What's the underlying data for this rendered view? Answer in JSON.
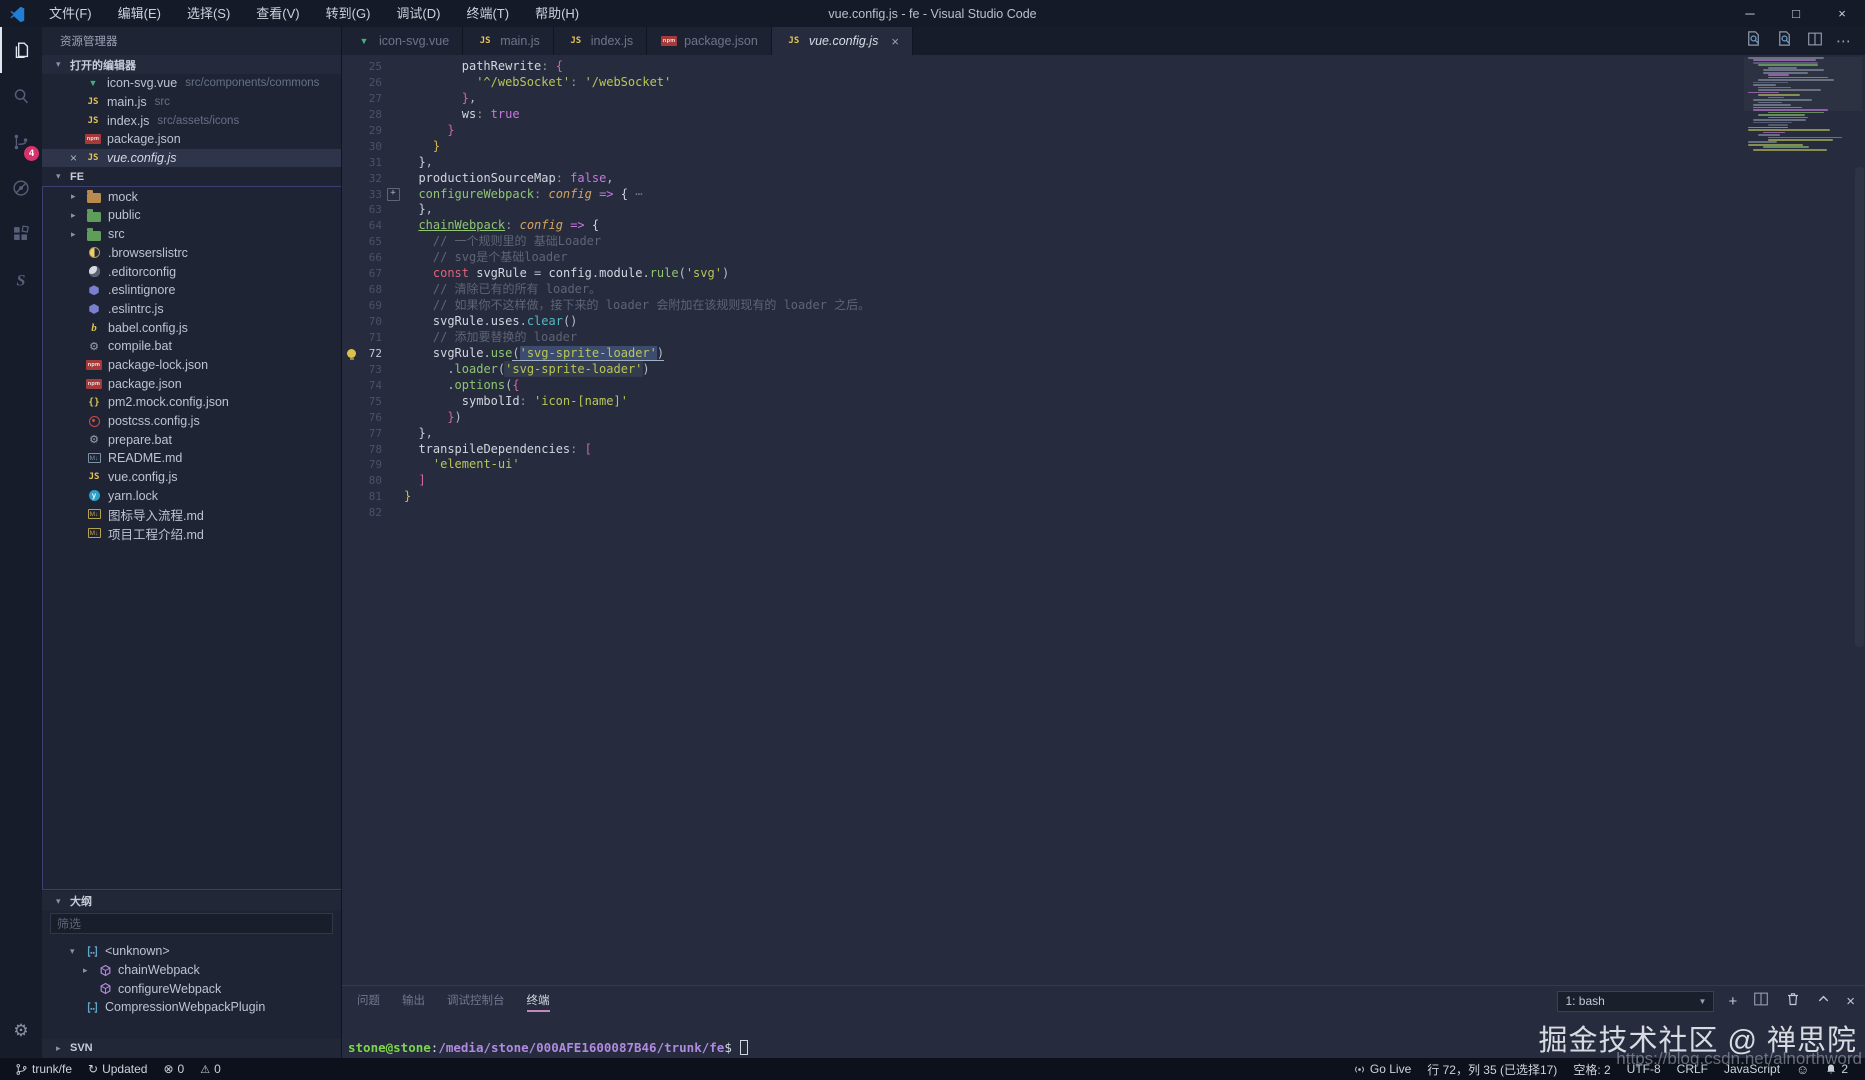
{
  "window": {
    "title": "vue.config.js - fe - Visual Studio Code",
    "menus": [
      "文件(F)",
      "编辑(E)",
      "选择(S)",
      "查看(V)",
      "转到(G)",
      "调试(D)",
      "终端(T)",
      "帮助(H)"
    ],
    "controls": [
      {
        "name": "minimize",
        "glyph": "─"
      },
      {
        "name": "maximize",
        "glyph": "□"
      },
      {
        "name": "close",
        "glyph": "×"
      }
    ]
  },
  "activity_bar": {
    "items": [
      {
        "name": "explorer",
        "active": true
      },
      {
        "name": "search"
      },
      {
        "name": "source-control",
        "badge": "4"
      },
      {
        "name": "debug"
      },
      {
        "name": "extensions"
      },
      {
        "name": "svn"
      }
    ],
    "bottom": [
      {
        "name": "settings",
        "glyph": "⚙"
      }
    ]
  },
  "sidebar": {
    "title": "资源管理器",
    "open_editors": {
      "label": "打开的编辑器",
      "items": [
        {
          "icon": "vue",
          "label": "icon-svg.vue",
          "desc": "src/components/commons"
        },
        {
          "icon": "js",
          "label": "main.js",
          "desc": "src"
        },
        {
          "icon": "js",
          "label": "index.js",
          "desc": "src/assets/icons"
        },
        {
          "icon": "npm",
          "label": "package.json",
          "desc": ""
        },
        {
          "icon": "js",
          "label": "vue.config.js",
          "desc": "",
          "active": true
        }
      ]
    },
    "tree": {
      "root": "FE",
      "items": [
        {
          "icon": "folder",
          "color": "#b98a4e",
          "label": "mock",
          "twisty": true
        },
        {
          "icon": "folder",
          "color": "#5e9e5a",
          "label": "public",
          "twisty": true
        },
        {
          "icon": "folder",
          "color": "#5e9e5a",
          "label": "src",
          "twisty": true
        },
        {
          "icon": "browserslist",
          "label": ".browserslistrc"
        },
        {
          "icon": "editorconfig",
          "label": ".editorconfig"
        },
        {
          "icon": "eslint",
          "label": ".eslintignore"
        },
        {
          "icon": "eslint",
          "label": ".eslintrc.js"
        },
        {
          "icon": "babel",
          "label": "babel.config.js"
        },
        {
          "icon": "gear",
          "label": "compile.bat"
        },
        {
          "icon": "npm",
          "label": "package-lock.json"
        },
        {
          "icon": "npm",
          "label": "package.json"
        },
        {
          "icon": "braces",
          "label": "pm2.mock.config.json"
        },
        {
          "icon": "postcss",
          "label": "postcss.config.js"
        },
        {
          "icon": "gear",
          "label": "prepare.bat"
        },
        {
          "icon": "markdown",
          "color": "#7c93a6",
          "label": "README.md"
        },
        {
          "icon": "js",
          "label": "vue.config.js"
        },
        {
          "icon": "yarn",
          "label": "yarn.lock"
        },
        {
          "icon": "markdown",
          "color": "#b7a14f",
          "label": "图标导入流程.md"
        },
        {
          "icon": "markdown",
          "color": "#b7a14f",
          "label": "项目工程介绍.md"
        }
      ]
    },
    "outline": {
      "label": "大纲",
      "filter_placeholder": "筛选",
      "items": [
        {
          "icon": "module",
          "label": "<unknown>",
          "twisty": "open",
          "indent": 0
        },
        {
          "icon": "method",
          "label": "chainWebpack",
          "twisty": "closed",
          "indent": 1
        },
        {
          "icon": "method",
          "label": "configureWebpack",
          "indent": 1
        },
        {
          "icon": "module",
          "label": "CompressionWebpackPlugin",
          "indent": 0
        }
      ]
    },
    "svn_label": "SVN"
  },
  "editor": {
    "tabs": [
      {
        "icon": "vue",
        "label": "icon-svg.vue"
      },
      {
        "icon": "js",
        "label": "main.js"
      },
      {
        "icon": "js",
        "label": "index.js"
      },
      {
        "icon": "npm",
        "label": "package.json"
      },
      {
        "icon": "js",
        "label": "vue.config.js",
        "active": true,
        "close": "×"
      }
    ],
    "actions": [
      {
        "name": "search-editor",
        "icon": "search-doc"
      },
      {
        "name": "search-history",
        "icon": "search-doc"
      },
      {
        "name": "split-editor",
        "icon": "split"
      },
      {
        "name": "more-actions",
        "icon": "ellipsis",
        "glyph": "⋯"
      }
    ],
    "lines": [
      {
        "n": 25,
        "ind": 4,
        "tk": [
          [
            "pr",
            "pathRewrite"
          ],
          [
            "pn",
            ": "
          ],
          [
            "b3",
            "{"
          ]
        ]
      },
      {
        "n": 26,
        "ind": 5,
        "tk": [
          [
            "st",
            "'^/webSocket'"
          ],
          [
            "pn",
            ": "
          ],
          [
            "st",
            "'/webSocket'"
          ]
        ]
      },
      {
        "n": 27,
        "ind": 4,
        "tk": [
          [
            "b3",
            "}"
          ],
          [
            "pu",
            ","
          ]
        ]
      },
      {
        "n": 28,
        "ind": 4,
        "tk": [
          [
            "pr",
            "ws"
          ],
          [
            "pn",
            ": "
          ],
          [
            "bo",
            "true"
          ]
        ]
      },
      {
        "n": 29,
        "ind": 3,
        "tk": [
          [
            "b3",
            "}"
          ]
        ]
      },
      {
        "n": 30,
        "ind": 2,
        "tk": [
          [
            "b1",
            "}"
          ]
        ]
      },
      {
        "n": 31,
        "ind": 1,
        "tk": [
          [
            "b2",
            "}"
          ],
          [
            "pu",
            ","
          ]
        ]
      },
      {
        "n": 32,
        "ind": 1,
        "tk": [
          [
            "pr",
            "productionSourceMap"
          ],
          [
            "pn",
            ": "
          ],
          [
            "bo",
            "false"
          ],
          [
            "pu",
            ","
          ]
        ]
      },
      {
        "n": 33,
        "ind": 1,
        "fold": true,
        "tk": [
          [
            "fn",
            "configureWebpack"
          ],
          [
            "pn",
            ": "
          ],
          [
            "pa",
            "config"
          ],
          [
            "pu",
            " "
          ],
          [
            "ar",
            "=>"
          ],
          [
            "pu",
            " "
          ],
          [
            "b2",
            "{"
          ],
          [
            "fd",
            " ⋯"
          ]
        ]
      },
      {
        "n": 63,
        "ind": 1,
        "tk": [
          [
            "b2",
            "}"
          ],
          [
            "pu",
            ","
          ]
        ]
      },
      {
        "n": 64,
        "ind": 1,
        "tk": [
          [
            "fn lnk",
            "chainWebpack"
          ],
          [
            "pn",
            ": "
          ],
          [
            "pa",
            "config"
          ],
          [
            "pu",
            " "
          ],
          [
            "ar",
            "=>"
          ],
          [
            "pu",
            " "
          ],
          [
            "b2",
            "{"
          ]
        ]
      },
      {
        "n": 65,
        "ind": 2,
        "tk": [
          [
            "cm",
            "// 一个规则里的 基础Loader"
          ]
        ]
      },
      {
        "n": 66,
        "ind": 2,
        "tk": [
          [
            "cm",
            "// svg是个基础loader"
          ]
        ]
      },
      {
        "n": 67,
        "ind": 2,
        "tk": [
          [
            "kw",
            "const"
          ],
          [
            "pu",
            " "
          ],
          [
            "pr",
            "svgRule"
          ],
          [
            "pu",
            " = "
          ],
          [
            "pr",
            "config"
          ],
          [
            "pu",
            "."
          ],
          [
            "pr",
            "module"
          ],
          [
            "pu",
            "."
          ],
          [
            "fn",
            "rule"
          ],
          [
            "pu",
            "("
          ],
          [
            "st",
            "'svg'"
          ],
          [
            "pu",
            ")"
          ]
        ]
      },
      {
        "n": 68,
        "ind": 2,
        "tk": [
          [
            "cm",
            "// 清除已有的所有 loader。"
          ]
        ]
      },
      {
        "n": 69,
        "ind": 2,
        "tk": [
          [
            "cm",
            "// 如果你不这样做，接下来的 loader 会附加在该规则现有的 loader 之后。"
          ]
        ]
      },
      {
        "n": 70,
        "ind": 2,
        "tk": [
          [
            "pr",
            "svgRule"
          ],
          [
            "pu",
            "."
          ],
          [
            "pr",
            "uses"
          ],
          [
            "pu",
            "."
          ],
          [
            "cy",
            "clear"
          ],
          [
            "pu",
            "()"
          ]
        ]
      },
      {
        "n": 71,
        "ind": 2,
        "tk": [
          [
            "cm",
            "// 添加要替换的 loader"
          ]
        ]
      },
      {
        "n": 72,
        "ind": 2,
        "glyph": "bulb",
        "tk": [
          [
            "pr",
            "svgRule"
          ],
          [
            "pu",
            "."
          ],
          [
            "fn",
            "use"
          ],
          [
            "pu und",
            "("
          ],
          [
            "st sel und",
            "'svg-sprite-loader'"
          ],
          [
            "pu und",
            ")"
          ]
        ]
      },
      {
        "n": 73,
        "ind": 3,
        "tk": [
          [
            "pu",
            "."
          ],
          [
            "fn",
            "loader"
          ],
          [
            "pu",
            "("
          ],
          [
            "st hl",
            "'svg-sprite-loader'"
          ],
          [
            "pu",
            ")"
          ]
        ]
      },
      {
        "n": 74,
        "ind": 3,
        "tk": [
          [
            "pu",
            "."
          ],
          [
            "fn",
            "options"
          ],
          [
            "pu",
            "("
          ],
          [
            "b3",
            "{"
          ]
        ]
      },
      {
        "n": 75,
        "ind": 4,
        "tk": [
          [
            "pr",
            "symbolId"
          ],
          [
            "pn",
            ": "
          ],
          [
            "st",
            "'icon-[name]'"
          ]
        ]
      },
      {
        "n": 76,
        "ind": 3,
        "tk": [
          [
            "b3",
            "}"
          ],
          [
            "pu",
            ")"
          ]
        ]
      },
      {
        "n": 77,
        "ind": 1,
        "tk": [
          [
            "b2",
            "}"
          ],
          [
            "pu",
            ","
          ]
        ]
      },
      {
        "n": 78,
        "ind": 1,
        "tk": [
          [
            "pr",
            "transpileDependencies"
          ],
          [
            "pn",
            ": "
          ],
          [
            "b3",
            "["
          ]
        ]
      },
      {
        "n": 79,
        "ind": 2,
        "tk": [
          [
            "st",
            "'element-ui'"
          ]
        ]
      },
      {
        "n": 80,
        "ind": 1,
        "tk": [
          [
            "b3",
            "]"
          ]
        ]
      },
      {
        "n": 81,
        "ind": 0,
        "tk": [
          [
            "b1",
            "}"
          ]
        ]
      },
      {
        "n": 82,
        "ind": 0,
        "tk": []
      }
    ]
  },
  "panel": {
    "tabs": [
      {
        "label": "问题"
      },
      {
        "label": "输出"
      },
      {
        "label": "调试控制台"
      },
      {
        "label": "终端",
        "active": true
      }
    ],
    "terminal": {
      "select": "1: bash",
      "prompt": [
        {
          "c": "t-user",
          "t": "stone@stone"
        },
        {
          "c": "t-pu",
          "t": ":"
        },
        {
          "c": "t-path",
          "t": "/media/stone/000AFE1600087B46/trunk/fe"
        },
        {
          "c": "t-pu",
          "t": "$ "
        }
      ]
    },
    "actions": [
      {
        "name": "new-terminal",
        "icon": "plus",
        "glyph": "+"
      },
      {
        "name": "split-terminal",
        "icon": "split"
      },
      {
        "name": "kill-terminal",
        "icon": "trash"
      },
      {
        "name": "maximize-panel",
        "icon": "chevron-up"
      },
      {
        "name": "close-panel",
        "icon": "close",
        "glyph": "×"
      }
    ]
  },
  "status_bar": {
    "left": [
      {
        "name": "branch",
        "icon": "branch",
        "label": "trunk/fe"
      },
      {
        "name": "sync",
        "icon": "sync",
        "label": "Updated"
      },
      {
        "name": "errors",
        "icon": "error",
        "label": "0"
      },
      {
        "name": "warnings",
        "icon": "warning",
        "label": "0"
      }
    ],
    "right": [
      {
        "name": "go-live",
        "icon": "broadcast",
        "label": "Go Live"
      },
      {
        "name": "cursor-position",
        "label": "行 72，列 35 (已选择17)"
      },
      {
        "name": "indentation",
        "label": "空格: 2"
      },
      {
        "name": "encoding",
        "label": "UTF-8"
      },
      {
        "name": "eol",
        "label": "CRLF"
      },
      {
        "name": "language",
        "label": "JavaScript"
      },
      {
        "name": "feedback",
        "icon": "smiley"
      },
      {
        "name": "notifications",
        "icon": "bell",
        "label": "2"
      }
    ]
  },
  "watermark": {
    "line1": "掘金技术社区 @ 禅思院",
    "line2": "https://blog.csdn.net/alnorthword"
  }
}
